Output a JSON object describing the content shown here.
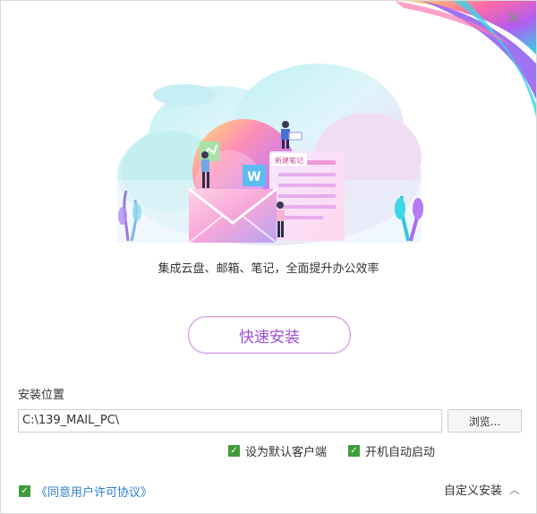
{
  "window": {
    "close_glyph": "✕"
  },
  "hero": {
    "slogan": "集成云盘、邮箱、笔记，全面提升办公效率",
    "note_card_label": "新建笔记",
    "doc_icon_letter": "W",
    "colors": {
      "cloud": "#c8f0f4",
      "accent_purple": "#9b4ed8",
      "accent_pink": "#f06aa8",
      "accent_cyan": "#3fd8e8"
    }
  },
  "actions": {
    "quick_install_label": "快速安装"
  },
  "install": {
    "path_label": "安装位置",
    "path_value": "C:\\139_MAIL_PC\\",
    "browse_label": "浏览..."
  },
  "options": {
    "default_client_label": "设为默认客户端",
    "default_client_checked": true,
    "autostart_label": "开机自动启动",
    "autostart_checked": true,
    "license_label": "《同意用户许可协议》",
    "license_checked": true,
    "check_glyph": "✓"
  },
  "footer": {
    "custom_install_label": "自定义安装",
    "chevron_glyph": "︿"
  }
}
